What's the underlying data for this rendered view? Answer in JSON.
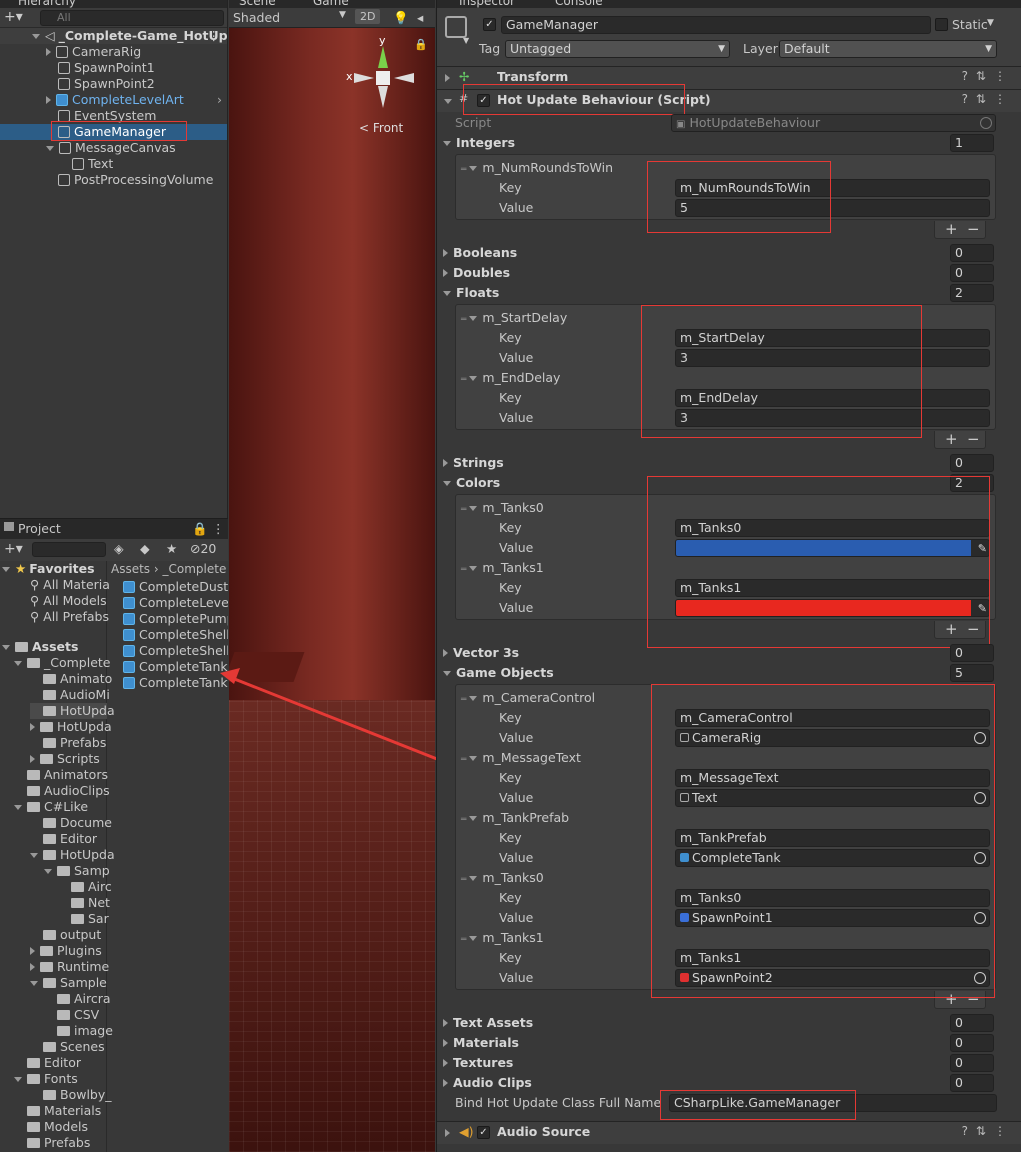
{
  "hierarchy": {
    "tab": "Hierarchy",
    "search_placeholder": "All",
    "scene_name": "_Complete-Game_HotUp",
    "items": [
      {
        "label": "CameraRig"
      },
      {
        "label": "SpawnPoint1"
      },
      {
        "label": "SpawnPoint2"
      },
      {
        "label": "CompleteLevelArt"
      },
      {
        "label": "EventSystem"
      },
      {
        "label": "GameManager"
      },
      {
        "label": "MessageCanvas"
      },
      {
        "label": "Text"
      },
      {
        "label": "PostProcessingVolume"
      }
    ]
  },
  "scene": {
    "tabs": [
      "Scene",
      "Game"
    ],
    "shading": "Shaded",
    "mode_2d": "2D",
    "gizmo_x": "x",
    "gizmo_y": "y",
    "gizmo_view": "Front"
  },
  "project": {
    "tab": "Project",
    "hidden_count": "20",
    "breadcrumb_root": "Assets",
    "breadcrumb_child": "_Complete",
    "favorites": {
      "label": "Favorites",
      "items": [
        "All Materia",
        "All Models",
        "All Prefabs"
      ]
    },
    "assets_label": "Assets",
    "tree": [
      "_Complete",
      "Animato",
      "AudioMi",
      "HotUpda",
      "HotUpda",
      "Prefabs",
      "Scripts",
      "Animators",
      "AudioClips",
      "C#Like",
      "Docume",
      "Editor",
      "HotUpda",
      "Samp",
      "Airc",
      "Net",
      "Sar",
      "output",
      "Plugins",
      "Runtime",
      "Sample",
      "Aircra",
      "CSV",
      "image",
      "Scenes",
      "Editor",
      "Fonts",
      "Bowlby_",
      "Materials",
      "Models",
      "Prefabs"
    ],
    "files": [
      "CompleteDustT",
      "CompleteLevel",
      "CompletePump",
      "CompleteShell",
      "CompleteShellE",
      "CompleteTank",
      "CompleteTankt"
    ]
  },
  "inspector": {
    "tabs": [
      "Inspector",
      "Console"
    ],
    "object_name": "GameManager",
    "static_label": "Static",
    "tag_label": "Tag",
    "tag_value": "Untagged",
    "layer_label": "Layer",
    "layer_value": "Default",
    "transform": "Transform",
    "component": "Hot Update Behaviour (Script)",
    "script_label": "Script",
    "script_value": "HotUpdateBehaviour",
    "key_label": "Key",
    "value_label": "Value",
    "integers": {
      "label": "Integers",
      "count": "1",
      "items": [
        {
          "name": "m_NumRoundsToWin",
          "key": "m_NumRoundsToWin",
          "value": "5"
        }
      ]
    },
    "booleans": {
      "label": "Booleans",
      "count": "0"
    },
    "doubles": {
      "label": "Doubles",
      "count": "0"
    },
    "floats": {
      "label": "Floats",
      "count": "2",
      "items": [
        {
          "name": "m_StartDelay",
          "key": "m_StartDelay",
          "value": "3"
        },
        {
          "name": "m_EndDelay",
          "key": "m_EndDelay",
          "value": "3"
        }
      ]
    },
    "strings": {
      "label": "Strings",
      "count": "0"
    },
    "colors": {
      "label": "Colors",
      "count": "2",
      "items": [
        {
          "name": "m_Tanks0",
          "key": "m_Tanks0",
          "color": "#2a5db0"
        },
        {
          "name": "m_Tanks1",
          "key": "m_Tanks1",
          "color": "#e8281f"
        }
      ]
    },
    "vector3s": {
      "label": "Vector 3s",
      "count": "0"
    },
    "gameobjects": {
      "label": "Game Objects",
      "count": "5",
      "items": [
        {
          "name": "m_CameraControl",
          "key": "m_CameraControl",
          "value": "CameraRig"
        },
        {
          "name": "m_MessageText",
          "key": "m_MessageText",
          "value": "Text"
        },
        {
          "name": "m_TankPrefab",
          "key": "m_TankPrefab",
          "value": "CompleteTank"
        },
        {
          "name": "m_Tanks0",
          "key": "m_Tanks0",
          "value": "SpawnPoint1"
        },
        {
          "name": "m_Tanks1",
          "key": "m_Tanks1",
          "value": "SpawnPoint2"
        }
      ]
    },
    "textassets": {
      "label": "Text Assets",
      "count": "0"
    },
    "materials": {
      "label": "Materials",
      "count": "0"
    },
    "textures": {
      "label": "Textures",
      "count": "0"
    },
    "audioclips": {
      "label": "Audio Clips",
      "count": "0"
    },
    "bind_label": "Bind Hot Update Class Full Name",
    "bind_value": "CSharpLike.GameManager",
    "audio_source": "Audio Source"
  },
  "colors": {
    "selection": "#2c5d87",
    "annotation": "#e53935"
  }
}
